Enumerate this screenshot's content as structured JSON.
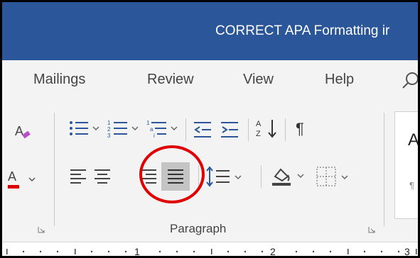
{
  "window": {
    "title": "CORRECT APA Formatting ir"
  },
  "tabs": [
    {
      "label": "Mailings"
    },
    {
      "label": "Review"
    },
    {
      "label": "View"
    },
    {
      "label": "Help"
    }
  ],
  "paragraph_group": {
    "label": "Paragraph",
    "active_alignment": "justify",
    "icons": [
      "bullets-icon",
      "numbering-icon",
      "multilevel-list-icon",
      "decrease-indent-icon",
      "increase-indent-icon",
      "sort-icon",
      "show-formatting-marks-icon",
      "align-left-icon",
      "align-center-icon",
      "align-right-icon",
      "justify-icon",
      "line-spacing-icon",
      "shading-icon",
      "borders-icon"
    ]
  },
  "font_group": {
    "icons": [
      "clear-formatting-icon",
      "font-color-icon"
    ]
  },
  "styles_group": {
    "preview_letter": "A",
    "pilcrow": "¶"
  },
  "ruler": {
    "labels": [
      "1",
      "2",
      "3"
    ]
  },
  "annotation": {
    "color": "#e00000",
    "target": "justify-icon"
  },
  "colors": {
    "title_bar": "#2b579a",
    "ribbon": "#f3f3f3",
    "font_color_bar": "#e00000"
  }
}
